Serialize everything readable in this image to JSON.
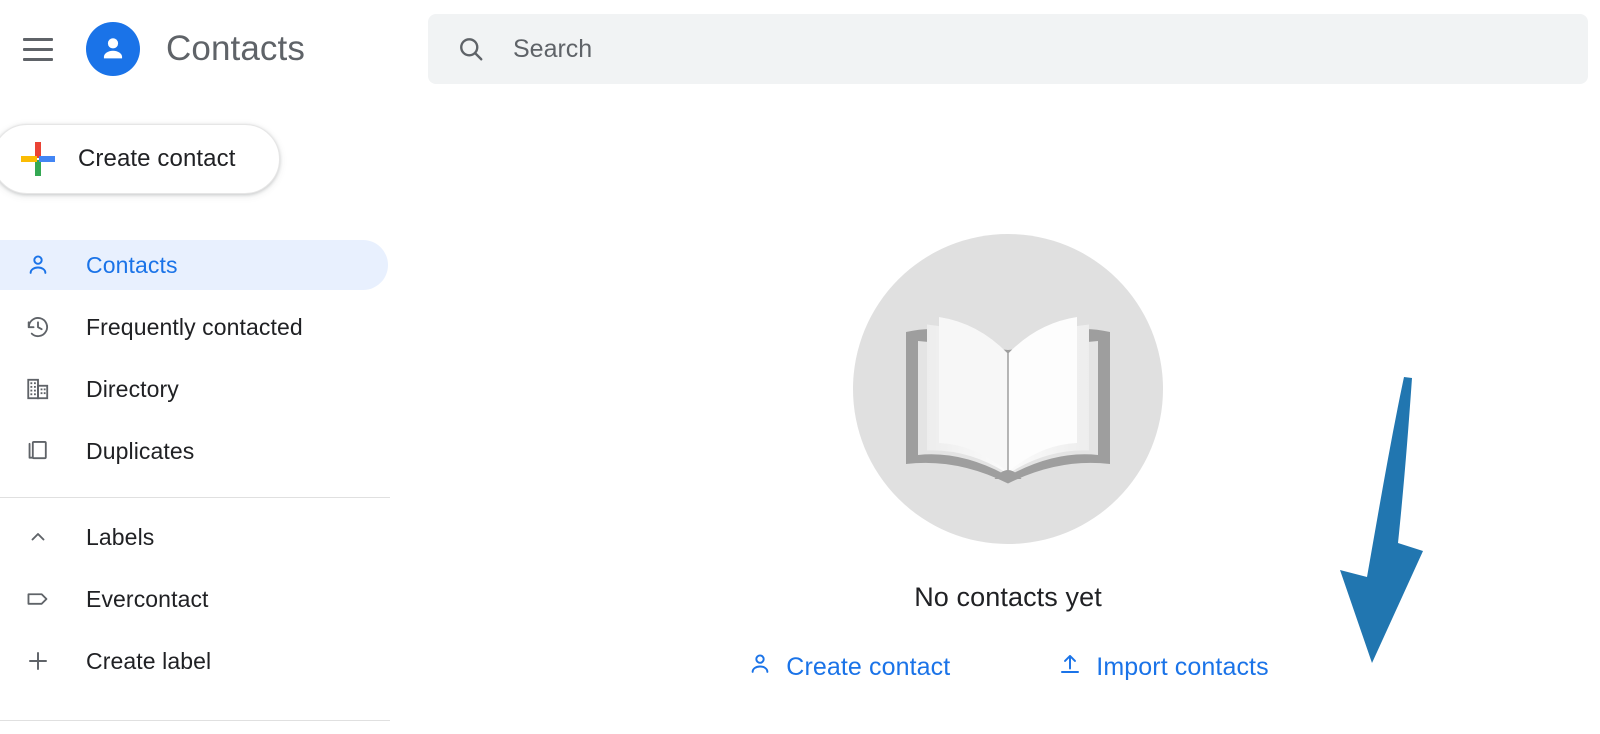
{
  "header": {
    "menu_icon": "hamburger-menu-icon",
    "app_icon": "contacts-avatar-icon",
    "title": "Contacts"
  },
  "search": {
    "icon": "search-icon",
    "placeholder": "Search",
    "value": ""
  },
  "create_button": {
    "icon": "google-plus-icon",
    "label": "Create contact"
  },
  "sidebar": {
    "items": [
      {
        "label": "Contacts",
        "icon": "person-icon",
        "active": true
      },
      {
        "label": "Frequently contacted",
        "icon": "history-icon",
        "active": false
      },
      {
        "label": "Directory",
        "icon": "building-icon",
        "active": false
      },
      {
        "label": "Duplicates",
        "icon": "duplicate-icon",
        "active": false
      }
    ],
    "labels_section": {
      "header": "Labels",
      "collapse_icon": "chevron-up-icon",
      "items": [
        {
          "label": "Evercontact",
          "icon": "label-tag-icon"
        },
        {
          "label": "Create label",
          "icon": "plus-icon"
        }
      ]
    }
  },
  "main": {
    "empty_state": {
      "illustration": "open-book-icon",
      "title": "No contacts yet",
      "actions": [
        {
          "label": "Create contact",
          "icon": "person-add-icon"
        },
        {
          "label": "Import contacts",
          "icon": "upload-icon"
        }
      ]
    }
  },
  "annotation": {
    "arrow": "down-arrow-annotation",
    "color": "#2176b0",
    "points_at": "Import contacts"
  },
  "colors": {
    "accent": "#1a73e8",
    "active_bg": "#e8f0fe",
    "text_primary": "#202124",
    "text_secondary": "#5f6368",
    "search_bg": "#f1f3f4",
    "illustration_bg": "#e0e0e0"
  }
}
